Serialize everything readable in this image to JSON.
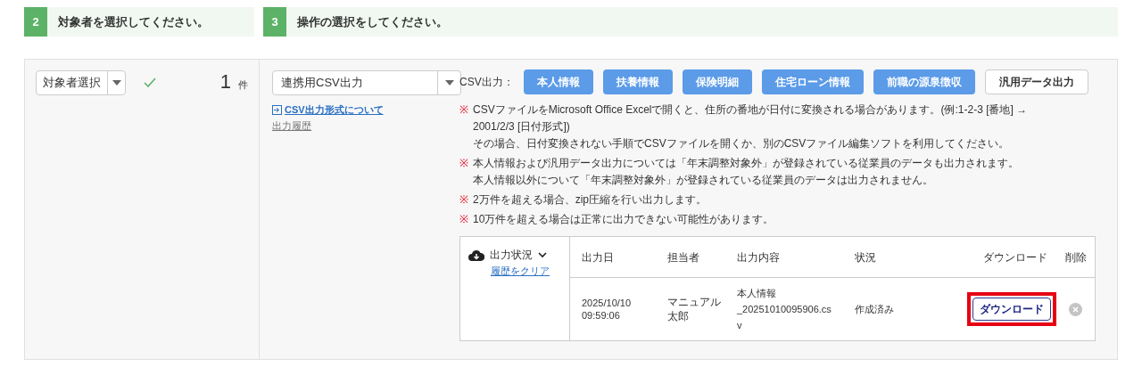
{
  "steps": [
    {
      "number": "2",
      "title": "対象者を選択してください。"
    },
    {
      "number": "3",
      "title": "操作の選択をしてください。"
    }
  ],
  "target": {
    "select": "対象者選択",
    "confirmed": true,
    "count": "1",
    "unit": "件"
  },
  "operation": {
    "select": "連携用CSV出力",
    "format_link": "CSV出力形式について",
    "history_link": "出力履歴"
  },
  "csv": {
    "label": "CSV出力：",
    "buttons": [
      {
        "label": "本人情報",
        "kind": "primary"
      },
      {
        "label": "扶養情報",
        "kind": "primary"
      },
      {
        "label": "保険明細",
        "kind": "primary"
      },
      {
        "label": "住宅ローン情報",
        "kind": "primary"
      },
      {
        "label": "前職の源泉徴収",
        "kind": "primary"
      },
      {
        "label": "汎用データ出力",
        "kind": "default"
      }
    ]
  },
  "notes": [
    {
      "mark": "※",
      "lines": [
        "CSVファイルをMicrosoft Office Excelで開くと、住所の番地が日付に変換される場合があります。(例:1-2-3 [番地] →",
        "2001/2/3 [日付形式])",
        "その場合、日付変換されない手順でCSVファイルを開くか、別のCSVファイル編集ソフトを利用してください。"
      ]
    },
    {
      "mark": "※",
      "lines": [
        "本人情報および汎用データ出力については「年末調整対象外」が登録されている従業員のデータも出力されます。",
        "本人情報以外について「年末調整対象外」が登録されている従業員のデータは出力されません。"
      ]
    },
    {
      "mark": "※",
      "lines": [
        "2万件を超える場合、zip圧縮を行い出力します。"
      ]
    },
    {
      "mark": "※",
      "lines": [
        "10万件を超える場合は正常に出力できない可能性があります。"
      ]
    }
  ],
  "output_status": {
    "title": "出力状況",
    "expanded": true,
    "clear_link": "履歴をクリア",
    "columns": [
      "出力日",
      "担当者",
      "出力内容",
      "状況",
      "ダウンロード",
      "削除"
    ],
    "rows": [
      {
        "date": [
          "2025/10/10",
          "09:59:06"
        ],
        "user": [
          "マニュアル",
          "太郎"
        ],
        "content": [
          "本人情報",
          "_20251010095906.cs",
          "v"
        ],
        "status": "作成済み",
        "download": "ダウンロード",
        "highlighted": true
      }
    ]
  }
}
